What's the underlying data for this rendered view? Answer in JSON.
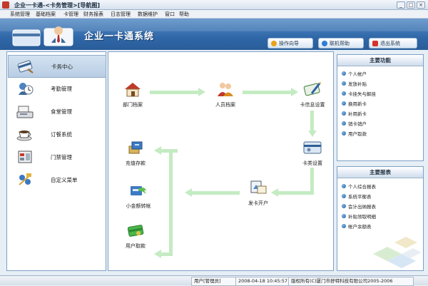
{
  "window": {
    "title": "企业一卡通-<卡务管理>[导航图]",
    "controls": [
      "_",
      "□",
      "×"
    ]
  },
  "menu": [
    "系统管理",
    "基础档案",
    "卡管理",
    "财务报表",
    "日志管理",
    "数据维护",
    "窗口",
    "帮助"
  ],
  "header": {
    "title": "企业一卡通系统",
    "buttons": [
      {
        "label": "操作向导",
        "icon": "star-icon",
        "color": "#e8a318"
      },
      {
        "label": "联机帮助",
        "icon": "help-icon",
        "color": "#2d7fd3"
      },
      {
        "label": "退出系统",
        "icon": "close-icon",
        "color": "#d9322b"
      }
    ]
  },
  "sidebar": {
    "items": [
      {
        "label": "卡务中心",
        "icon": "card-icon",
        "active": true
      },
      {
        "label": "考勤管理",
        "icon": "clock-icon",
        "active": false
      },
      {
        "label": "食堂管理",
        "icon": "pos-terminal-icon",
        "active": false
      },
      {
        "label": "订餐系统",
        "icon": "coffee-icon",
        "active": false
      },
      {
        "label": "门禁管理",
        "icon": "door-access-icon",
        "active": false
      },
      {
        "label": "自定义菜单",
        "icon": "custom-menu-icon",
        "active": false
      }
    ]
  },
  "workflow": {
    "nodes": {
      "dept": {
        "label": "部门档案",
        "icon": "house-icon"
      },
      "staff": {
        "label": "人员档案",
        "icon": "people-icon"
      },
      "cardinfo": {
        "label": "卡信息设置",
        "icon": "card-edit-icon"
      },
      "cardtype": {
        "label": "卡类设置",
        "icon": "card-type-icon"
      },
      "issue": {
        "label": "发卡开户",
        "icon": "issue-card-icon"
      },
      "transfer": {
        "label": "小金额转帐",
        "icon": "transfer-icon"
      },
      "deposit": {
        "label": "充值存款",
        "icon": "deposit-icon"
      },
      "withdraw": {
        "label": "用户取款",
        "icon": "withdraw-icon"
      }
    }
  },
  "right_panels": [
    {
      "title": "主要功能",
      "items": [
        "个人帐户",
        "发放补贴",
        "卡挂失与解挂",
        "换用新卡",
        "补用新卡",
        "销卡销户",
        "用户取款"
      ]
    },
    {
      "title": "主要报表",
      "items": [
        "个人综合报表",
        "系统平衡表",
        "会计出纳报表",
        "补贴领取明细",
        "帐户余额表"
      ]
    }
  ],
  "status": {
    "user": "用户[管理员]",
    "datetime": "2008-04-18 10:45:57",
    "copyright": "版权所有(C)厦门市舒特科技有限公司2005-2006"
  }
}
